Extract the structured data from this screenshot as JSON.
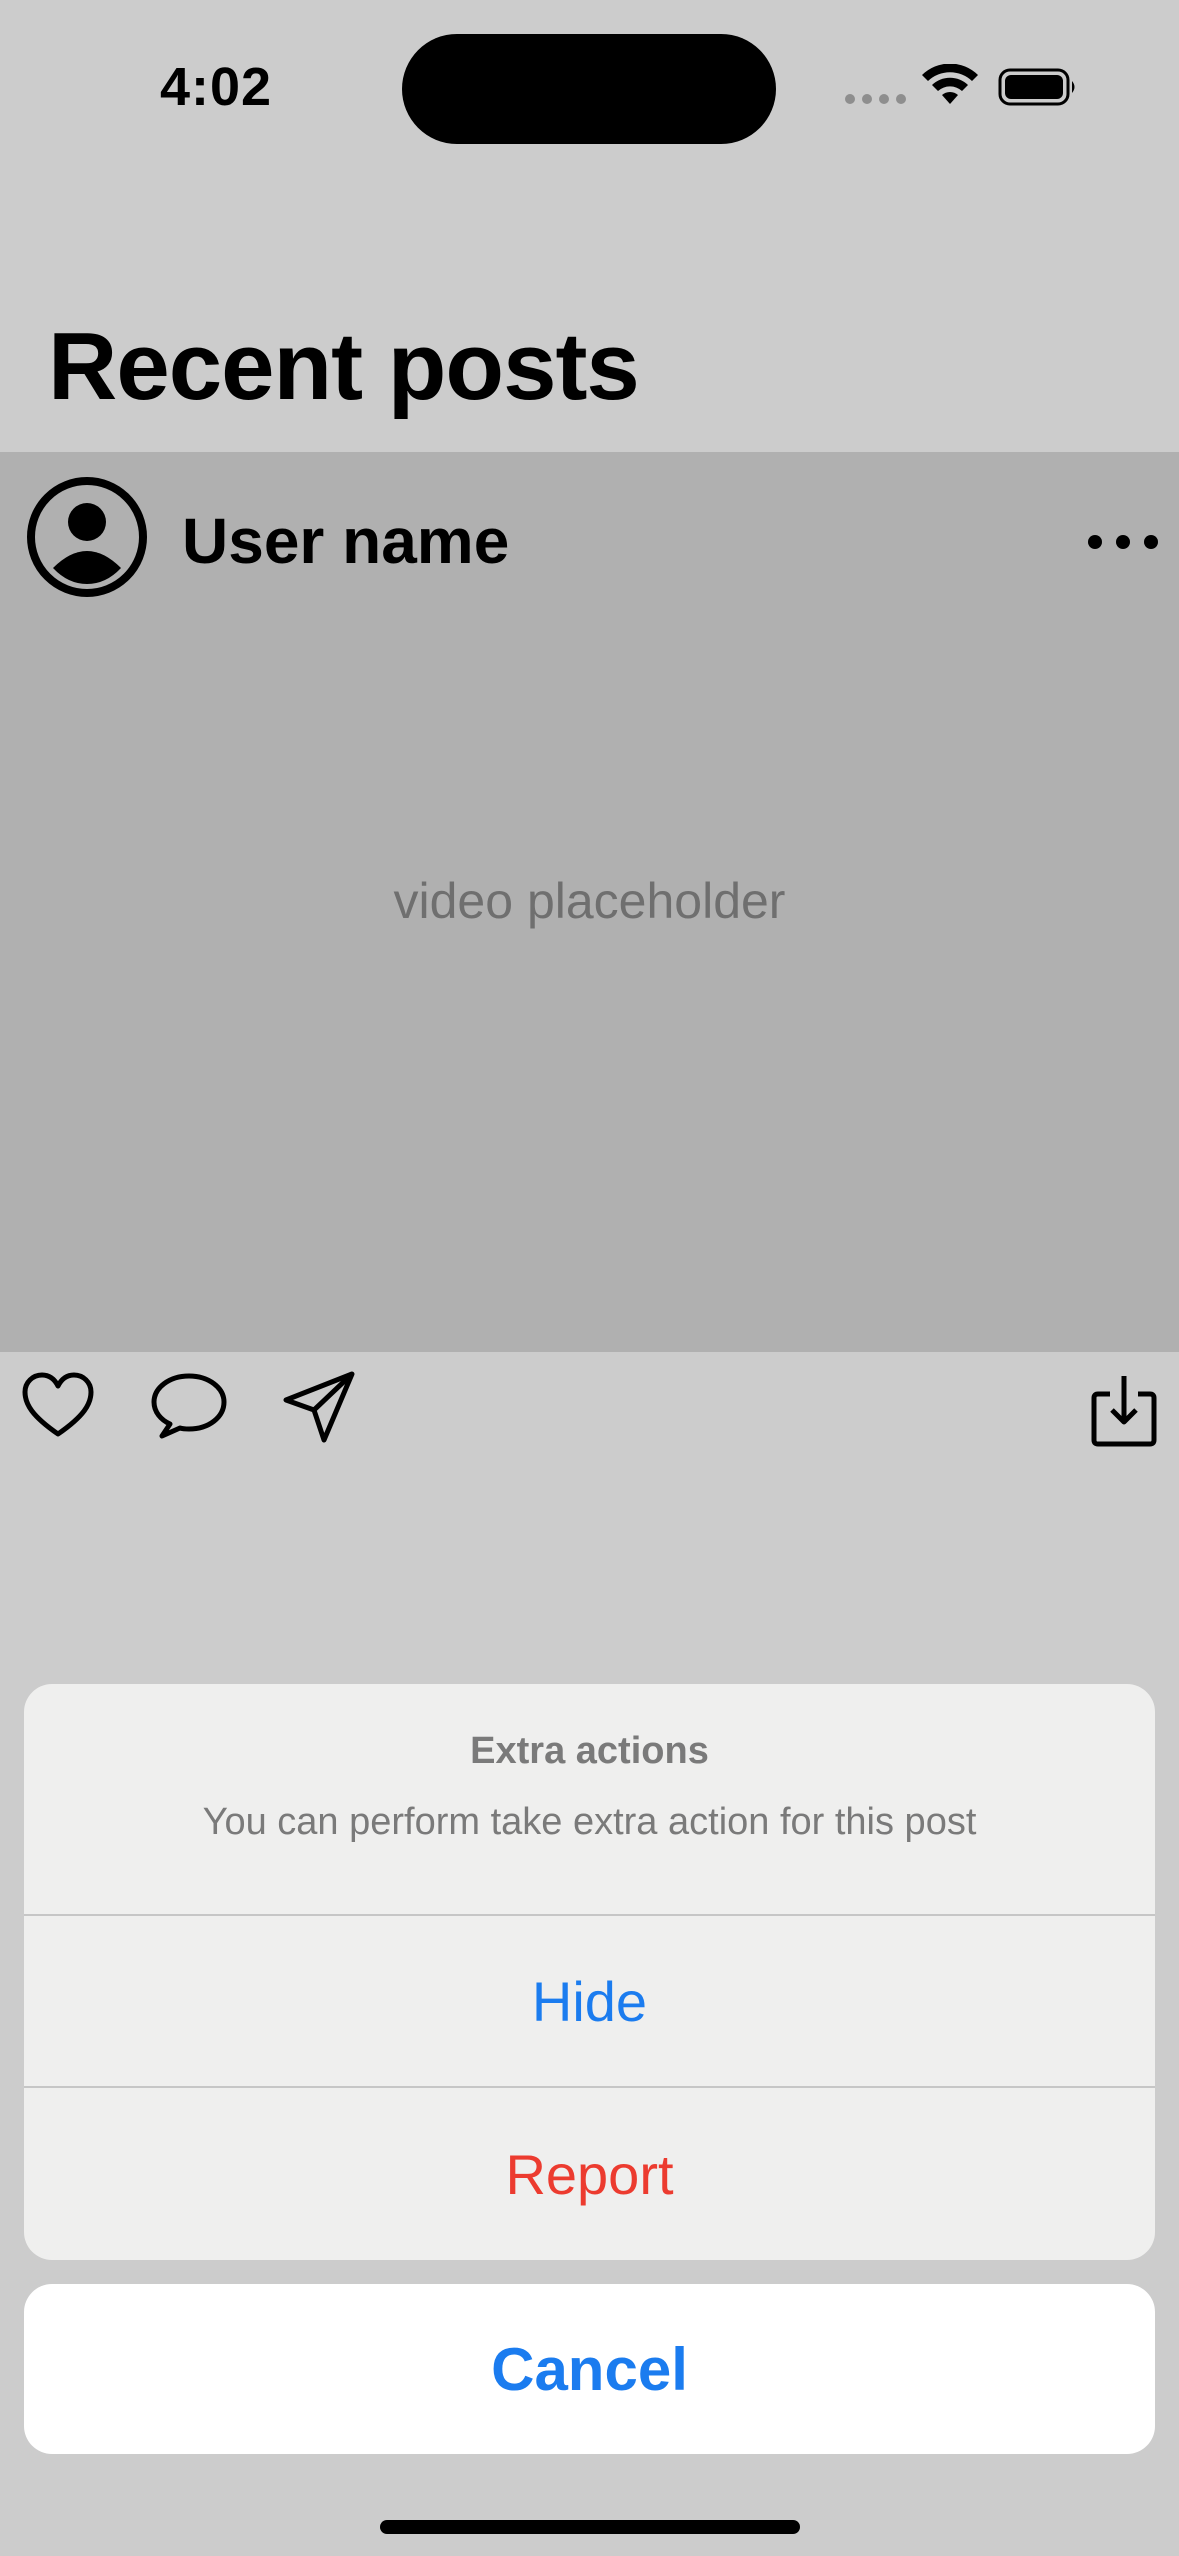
{
  "status_bar": {
    "time": "4:02",
    "icons": [
      "signal-icon",
      "wifi-icon",
      "battery-icon"
    ]
  },
  "page": {
    "title": "Recent posts"
  },
  "post": {
    "user_name": "User name",
    "video_placeholder": "video placeholder",
    "icons": [
      "avatar-icon",
      "more-icon",
      "heart-icon",
      "comment-icon",
      "share-icon",
      "download-icon"
    ]
  },
  "action_sheet": {
    "title": "Extra actions",
    "message": "You can perform take extra action for this post",
    "options": [
      {
        "label": "Hide",
        "color": "#1b7cef"
      },
      {
        "label": "Report",
        "color": "#ec3b2f"
      }
    ],
    "cancel_label": "Cancel"
  },
  "colors": {
    "background": "#cccccc",
    "post_background": "#b0b0b0",
    "accent": "#1b7cef",
    "destructive": "#ec3b2f"
  }
}
